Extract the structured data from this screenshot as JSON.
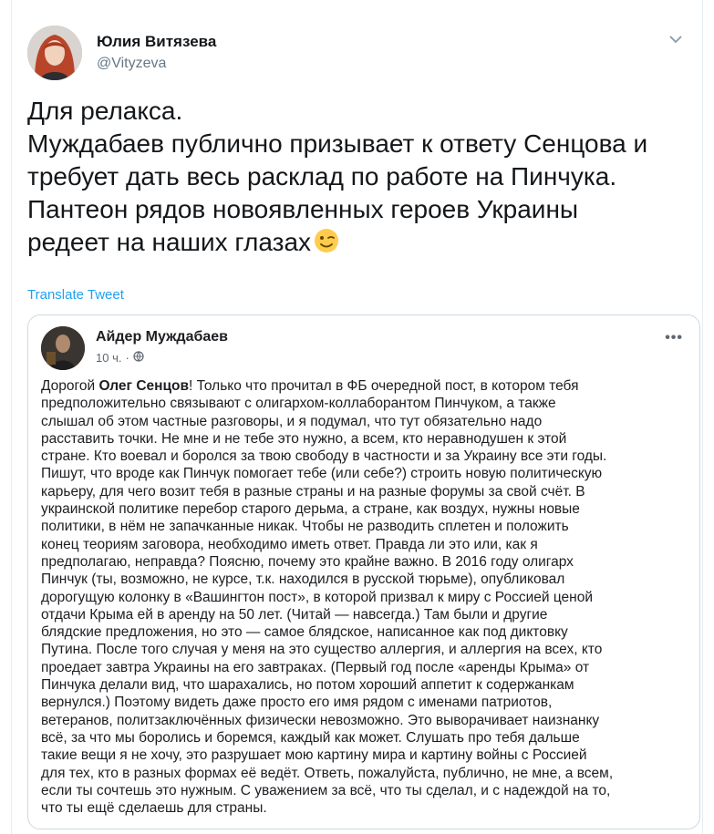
{
  "tweet": {
    "author_name": "Юлия Витязева",
    "author_handle": "@Vityzeva",
    "text_lines": [
      "Для релакса.",
      "Муждабаев публично призывает к ответу Сенцова и",
      "требует дать весь расклад по работе на Пинчука.",
      "Пантеон рядов новоявленных героев Украины",
      "редеет на наших глазах"
    ],
    "emoji_icon": "winking-face-icon",
    "translate_label": "Translate Tweet"
  },
  "embed": {
    "author_name": "Айдер Муждабаев",
    "time": "10 ч.",
    "separator": "·",
    "more_label": "•••",
    "first_line_prefix": "Дорогой ",
    "first_line_bold": "Олег Сенцов",
    "first_line_suffix": "! Только что прочитал в ФБ очередной пост, в котором тебя",
    "body_lines": [
      "предположительно связывают с олигархом-коллаборантом Пинчуком, а также",
      "слышал об этом частные разговоры, и я подумал, что тут обязательно надо",
      "расставить точки. Не мне и не тебе это нужно, а всем, кто неравнодушен к этой",
      "стране. Кто воевал и боролся за твою свободу в частности и за Украину все эти годы.",
      "Пишут, что вроде как Пинчук помогает тебе (или себе?) строить новую политическую",
      "карьеру, для чего возит тебя в разные страны и на разные форумы за свой счёт. В",
      "украинской политике перебор старого дерьма, а стране, как воздух, нужны новые",
      "политики, в нём не запачканные никак. Чтобы не разводить сплетен и положить",
      "конец теориям заговора, необходимо иметь ответ. Правда ли это или, как я",
      "предполагаю, неправда? Поясню, почему это крайне важно. В 2016 году олигарх",
      "Пинчук (ты, возможно, не курсе, т.к. находился в русской тюрьме), опубликовал",
      "дорогущую колонку в «Вашингтон пост», в которой призвал к миру с Россией ценой",
      "отдачи Крыма ей в аренду на 50 лет. (Читай — навсегда.) Там были и другие",
      "блядские предложения, но это — самое блядское, написанное как под диктовку",
      "Путина. После того случая у меня на это существо аллергия, и аллергия на всех, кто",
      "проедает завтра Украины на его завтраках. (Первый год после «аренды Крыма» от",
      "Пинчука делали вид, что шарахались, но потом хороший аппетит к содержанкам",
      "вернулся.) Поэтому видеть даже просто его имя рядом с именами патриотов,",
      "ветеранов, политзаключённых физически невозможно. Это выворачивает наизнанку",
      "всё, за что мы боролись и боремся, каждый как может. Слушать про тебя дальше",
      "такие вещи я не хочу, это разрушает мою картину мира и картину войны с Россией",
      "для тех, кто в разных формах её ведёт. Ответь, пожалуйста, публично, не мне, а всем,",
      "если ты сочтешь это нужным. С уважением за всё, что ты сделал, и с надеждой на то,",
      "что ты ещё сделаешь для страны."
    ]
  },
  "colors": {
    "link": "#1da1f2",
    "secondary_text": "#657786",
    "border": "#cfd9de"
  }
}
